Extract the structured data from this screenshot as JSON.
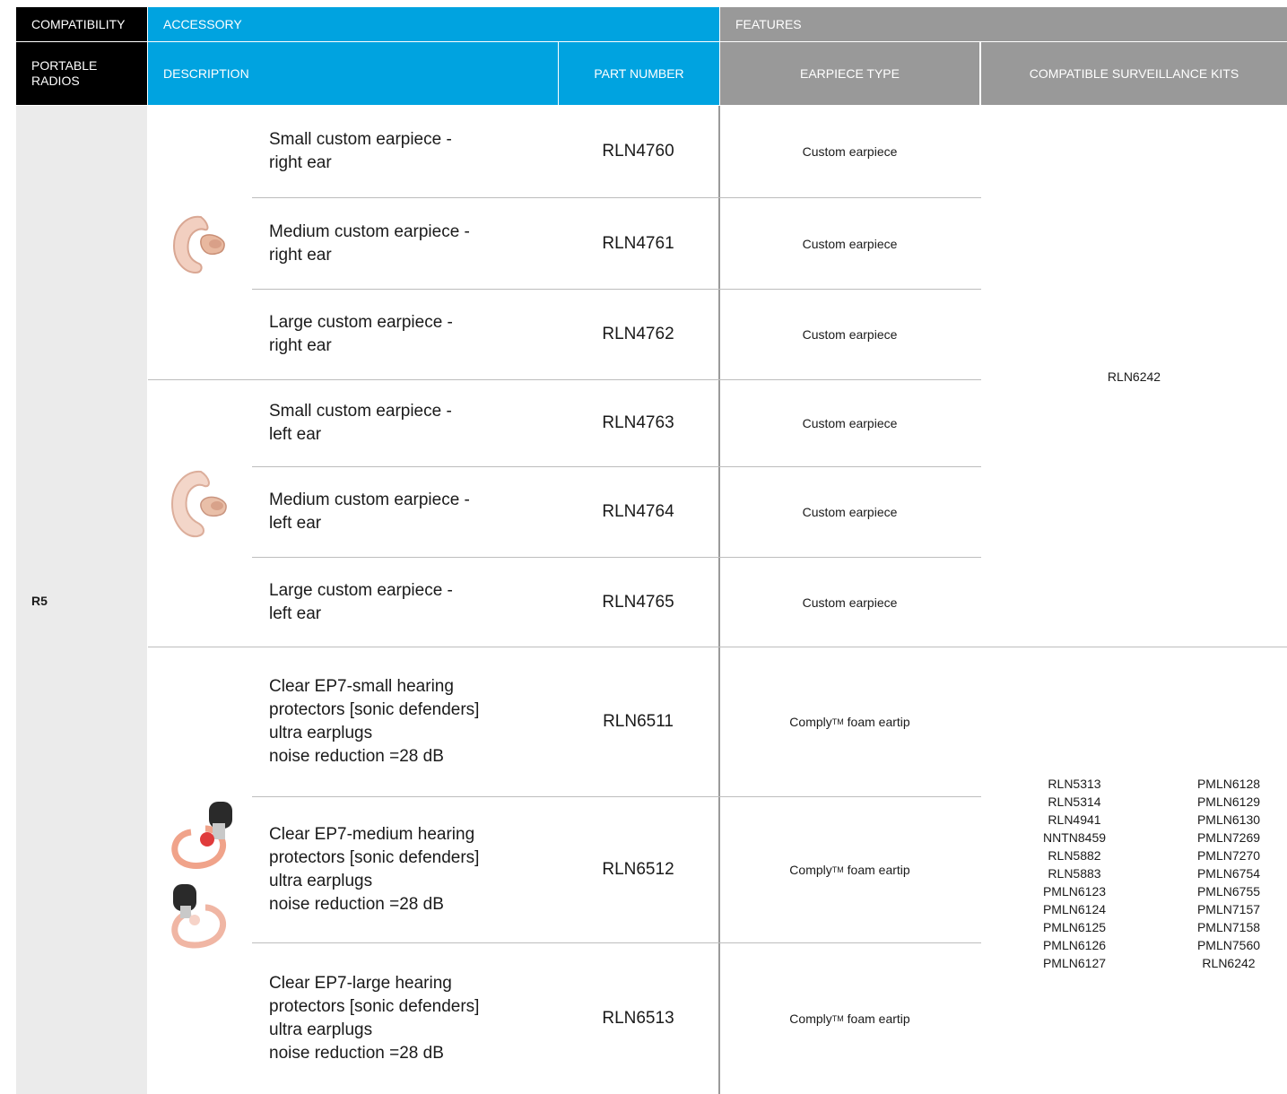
{
  "header": {
    "compatibility": "COMPATIBILITY",
    "accessory": "ACCESSORY",
    "features": "FEATURES",
    "portable_radios": "PORTABLE\nRADIOS",
    "description": "DESCRIPTION",
    "part_number": "PART NUMBER",
    "earpiece_type": "EARPIECE TYPE",
    "compatible_kits": "COMPATIBLE SURVEILLANCE KITS"
  },
  "radio": "R5",
  "rows": [
    {
      "description": "Small custom earpiece -\nright ear",
      "part": "RLN4760",
      "type": "Custom earpiece"
    },
    {
      "description": "Medium custom earpiece -\nright ear",
      "part": "RLN4761",
      "type": "Custom earpiece"
    },
    {
      "description": "Large custom earpiece -\nright ear",
      "part": "RLN4762",
      "type": "Custom earpiece"
    },
    {
      "description": "Small custom earpiece -\nleft ear",
      "part": "RLN4763",
      "type": "Custom earpiece"
    },
    {
      "description": "Medium custom earpiece -\nleft ear",
      "part": "RLN4764",
      "type": "Custom earpiece"
    },
    {
      "description": "Large custom earpiece -\nleft ear",
      "part": "RLN4765",
      "type": "Custom earpiece"
    },
    {
      "description": "Clear EP7-small hearing\nprotectors [sonic defenders]\nultra earplugs\nnoise reduction =28 dB",
      "part": "RLN6511",
      "type_main": "Comply",
      "type_sup": "TM",
      "type_rest": " foam eartip"
    },
    {
      "description": "Clear EP7-medium hearing\nprotectors [sonic defenders]\nultra earplugs\nnoise reduction =28 dB",
      "part": "RLN6512",
      "type_main": "Comply",
      "type_sup": "TM",
      "type_rest": " foam eartip"
    },
    {
      "description": "Clear EP7-large hearing\nprotectors [sonic defenders]\nultra earplugs\nnoise reduction =28 dB",
      "part": "RLN6513",
      "type_main": "Comply",
      "type_sup": "TM",
      "type_rest": " foam eartip"
    }
  ],
  "kits_group1": "RLN6242",
  "kits_group2_col1": "RLN5313\nRLN5314\nRLN4941\nNNTN8459\nRLN5882\nRLN5883\nPMLN6123\nPMLN6124\nPMLN6125\nPMLN6126\nPMLN6127",
  "kits_group2_col2": "PMLN6128\nPMLN6129\nPMLN6130\nPMLN7269\nPMLN7270\nPMLN6754\nPMLN6755\nPMLN7157\nPMLN7158\nPMLN7560\nRLN6242",
  "colors": {
    "blue": "#00a3e0",
    "grey": "#999999",
    "black": "#000000",
    "radio_bg": "#ebebeb"
  }
}
